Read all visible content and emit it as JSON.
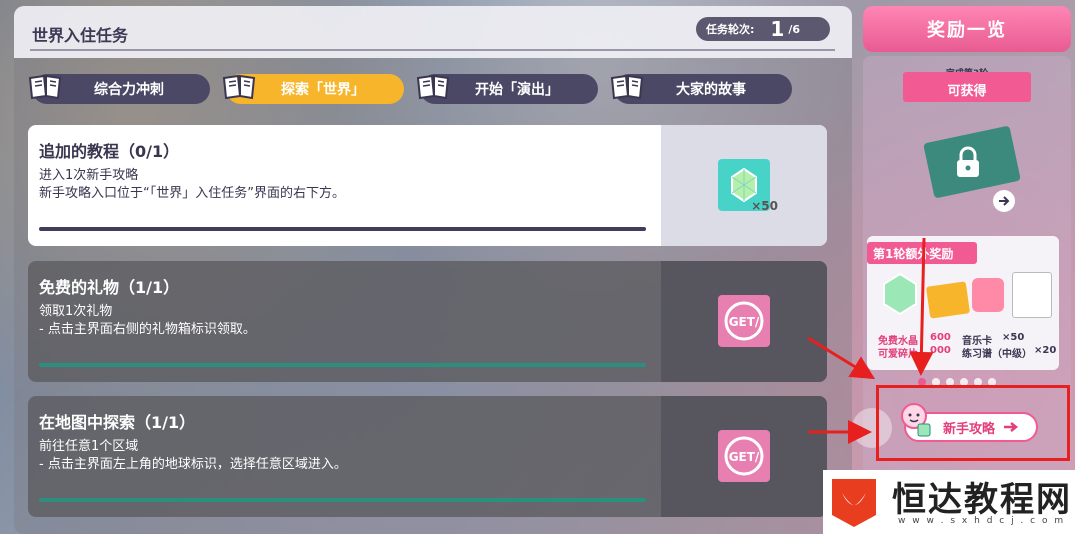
{
  "header": {
    "title": "世界入住任务",
    "round_label": "任务轮次:",
    "round_current": "1",
    "round_total": "/6"
  },
  "tabs": [
    {
      "label": "综合力冲刺",
      "active": false
    },
    {
      "label": "探索「世界」",
      "active": true
    },
    {
      "label": "开始「演出」",
      "active": false
    },
    {
      "label": "大家的故事",
      "active": false
    }
  ],
  "tasks": [
    {
      "title": "追加的教程（0/1）",
      "desc_line1": "进入1次新手攻略",
      "desc_line2": "新手攻略入口位于“「世界」入住任务”界面的右下方。",
      "reward": "crystal",
      "reward_count": "×50",
      "state": "active",
      "progress": 0
    },
    {
      "title": "免费的礼物（1/1）",
      "desc_line1": "领取1次礼物",
      "desc_line2": "- 点击主界面右侧的礼物箱标识领取。",
      "reward": "get",
      "reward_stamp": "GET/",
      "state": "done",
      "progress": 1
    },
    {
      "title": "在地图中探索（1/1）",
      "desc_line1": "前往任意1个区域",
      "desc_line2": "- 点击主界面左上角的地球标识，选择任意区域进入。",
      "reward": "get",
      "reward_stamp": "GET/",
      "state": "done",
      "progress": 1
    }
  ],
  "sidebar": {
    "header": "奖励一览",
    "ribbon_line1": "完成第3轮",
    "ribbon_line2": "可获得",
    "bonus_badge": "第1轮额外奖励",
    "bonus_items": [
      {
        "label": "免费水晶",
        "count": "600"
      },
      {
        "label": "可爱碎片",
        "count": "000"
      },
      {
        "label": "音乐卡",
        "count": "×50"
      },
      {
        "label": "练习谱（中级）",
        "count": "×20"
      }
    ],
    "pager_dots": 6,
    "guide_button": "新手攻略"
  },
  "watermark": {
    "text": "恒达教程网",
    "url": "w w w . s x h d c j . c o m"
  },
  "colors": {
    "accent_pink": "#f25a93",
    "tab_active": "#f7b52c",
    "tab_inactive": "#4b4866",
    "progress_done": "#2b8f7e",
    "highlight_red": "#e81f1f"
  }
}
